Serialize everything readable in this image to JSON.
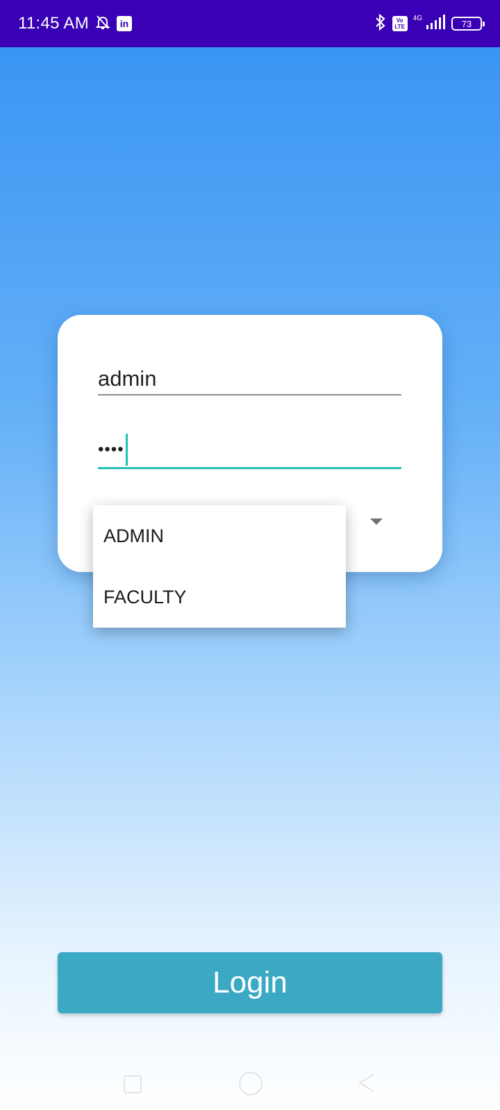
{
  "status_bar": {
    "time": "11:45 AM",
    "left_icons": [
      "bell-off-icon",
      "linkedin-icon"
    ],
    "linkedin_glyph": "in",
    "right_icons": [
      "bluetooth-icon",
      "volte-icon",
      "signal-icon",
      "battery-icon"
    ],
    "volte_text_top": "Vo",
    "volte_text_bottom": "LTE",
    "network": "4G",
    "battery": "73"
  },
  "login_form": {
    "username_value": "admin",
    "password_dots": "••••",
    "role_options": [
      "ADMIN",
      "FACULTY"
    ]
  },
  "login_button": {
    "label": "Login",
    "color": "#3ba8c4"
  },
  "colors": {
    "status_bar": "#3a00b5",
    "accent": "#22c3b6"
  }
}
